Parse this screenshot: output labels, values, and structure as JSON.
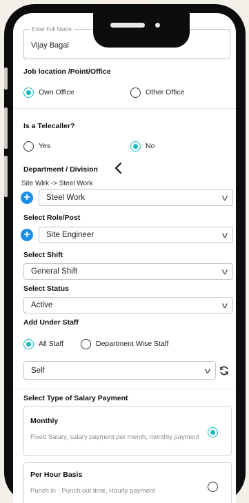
{
  "full_name": {
    "legend": "Enter Full Name",
    "value": "Vijay Bagal"
  },
  "job_location": {
    "label": "Job location /Point/Office",
    "options": [
      {
        "label": "Own Office",
        "selected": true
      },
      {
        "label": "Other Office",
        "selected": false
      }
    ]
  },
  "telecaller": {
    "label": "Is a Telecaller?",
    "options": [
      {
        "label": "Yes",
        "selected": false
      },
      {
        "label": "No",
        "selected": true
      }
    ]
  },
  "department": {
    "label": "Department / Division",
    "back_icon": "chevron-left-icon",
    "path": "Site Wlrk -> Steel Work",
    "selected": "Steel Work"
  },
  "role": {
    "label": "Select Role/Post",
    "selected": "Site Engineer"
  },
  "shift": {
    "label": "Select Shift",
    "selected": "General Shift"
  },
  "status": {
    "label": "Select Status",
    "selected": "Active"
  },
  "add_under_staff": {
    "label": "Add Under Staff",
    "options": [
      {
        "label": "All Staff",
        "selected": true
      },
      {
        "label": "Department Wise Staff",
        "selected": false
      }
    ],
    "selected": "Self"
  },
  "salary": {
    "label": "Select Type of Salary Payment",
    "options": [
      {
        "title": "Monthly",
        "desc": "Fixed Salary, salary payment per month, monthly payment",
        "selected": true
      },
      {
        "title": "Per Hour Basis",
        "desc": "Punch in - Punch out time, Hourly payment",
        "selected": false
      }
    ]
  },
  "colors": {
    "accent": "#15b9c8",
    "plus_button": "#1a8fe8",
    "phone_frame": "#0d0d0d"
  }
}
